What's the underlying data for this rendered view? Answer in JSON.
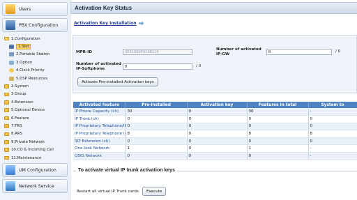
{
  "sidebar": {
    "users_label": "Users",
    "pbx_label": "PBX Configuration",
    "tree": [
      {
        "label": "1.Configuration",
        "level": 1,
        "icon": "folder-open-icon"
      },
      {
        "label": "1.Slot",
        "level": 2,
        "icon": "slot-icon",
        "selected": true
      },
      {
        "label": "2.Portable Station",
        "level": 2,
        "icon": "portable-station-icon"
      },
      {
        "label": "3.Option",
        "level": 2,
        "icon": "option-icon"
      },
      {
        "label": "4.Clock Priority",
        "level": 2,
        "icon": "clock-icon"
      },
      {
        "label": "5.DSP Resources",
        "level": 2,
        "icon": "dsp-icon"
      },
      {
        "label": "2.System",
        "level": 1,
        "icon": "folder-icon"
      },
      {
        "label": "3.Group",
        "level": 1,
        "icon": "folder-icon"
      },
      {
        "label": "4.Extension",
        "level": 1,
        "icon": "folder-icon"
      },
      {
        "label": "5.Optional Device",
        "level": 1,
        "icon": "folder-icon"
      },
      {
        "label": "6.Feature",
        "level": 1,
        "icon": "folder-icon"
      },
      {
        "label": "7.TRS",
        "level": 1,
        "icon": "folder-icon"
      },
      {
        "label": "8.ARS",
        "level": 1,
        "icon": "folder-icon"
      },
      {
        "label": "9.Private Network",
        "level": 1,
        "icon": "folder-icon"
      },
      {
        "label": "10.CO & Incoming Call",
        "level": 1,
        "icon": "folder-icon"
      },
      {
        "label": "11.Maintenance",
        "level": 1,
        "icon": "folder-icon"
      }
    ],
    "um_label": "UM Configuration",
    "network_label": "Network Service"
  },
  "main": {
    "title": "Activation Key Status",
    "link_label": "Activation Key Installation",
    "mpr_id_label": "MPR-ID",
    "mpr_id_value": "3E0180DF0C0B1C0",
    "activated_ipgw_label": "Number of activated IP-GW",
    "activated_ipgw_value": "0",
    "activated_ipgw_suffix": "/ 0",
    "activated_softphone_label": "Number of activated IP-Softphone",
    "activated_softphone_value": "0",
    "activated_softphone_suffix": "/ 0",
    "activate_button": "Activate Pre-installed Activation keys",
    "table": {
      "headers": [
        "Activated feature",
        "Pre-installed",
        "Activation key",
        "Features in total",
        "System to"
      ],
      "rows": [
        [
          "IP Phone Capacity (ch)",
          "30",
          "0",
          "30",
          "-"
        ],
        [
          "IP Trunk (ch)",
          "0",
          "0",
          "0",
          "0"
        ],
        [
          "IP Proprietary Telephone/IP Softp",
          "0",
          "0",
          "0",
          "0"
        ],
        [
          "IP Proprietary Telephone (ch)",
          "8",
          "0",
          "8",
          "8"
        ],
        [
          "SIP Extension (ch)",
          "0",
          "0",
          "0",
          "0"
        ],
        [
          "One-look Network",
          "1",
          "0",
          "1",
          "-"
        ],
        [
          "QSIG Network",
          "0",
          "0",
          "0",
          "-"
        ]
      ]
    },
    "virtual_section_title": "To activate virtual IP trunk activation keys",
    "restart_label": "Restart all virtual IP Trunk cards.",
    "execute_button": "Execute"
  }
}
